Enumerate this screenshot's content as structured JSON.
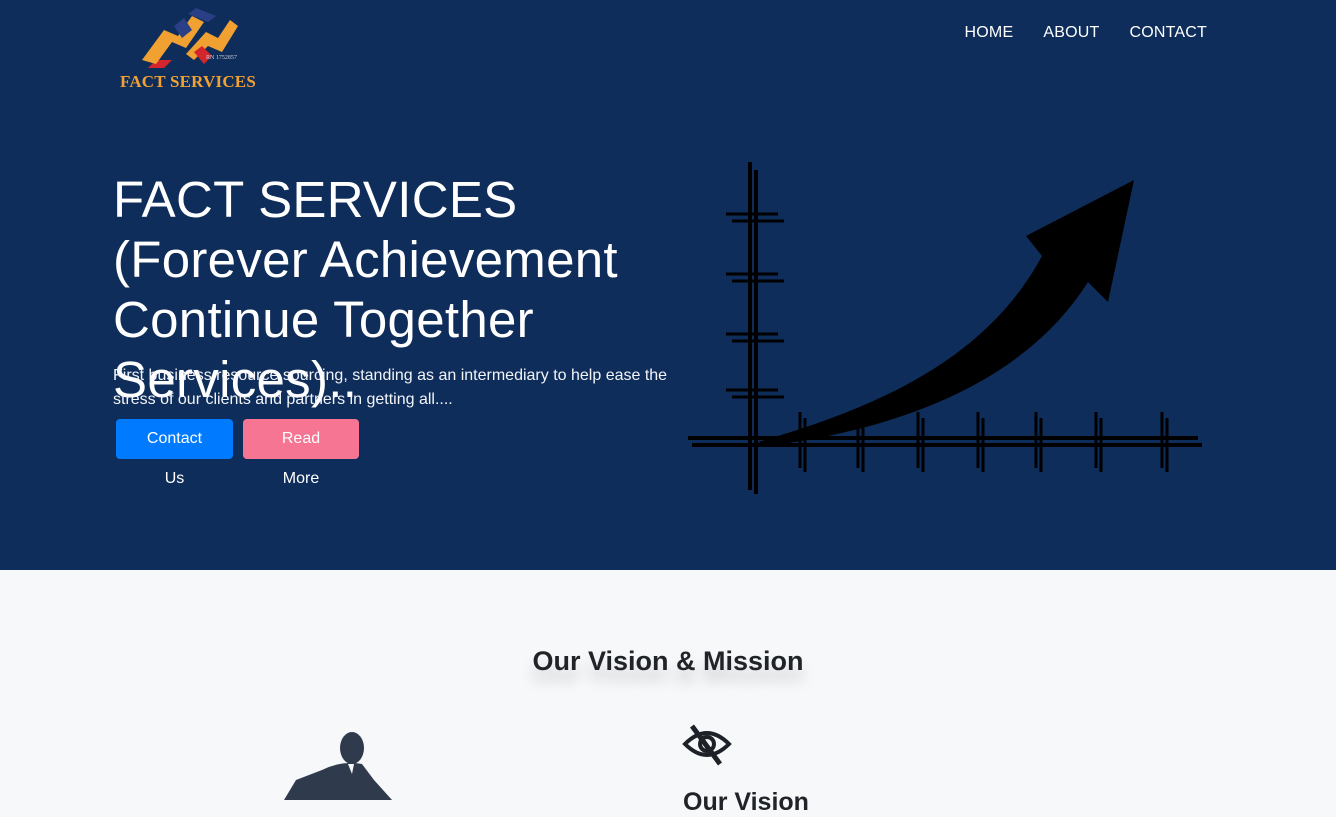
{
  "brand": {
    "name": "FACT SERVICES",
    "registration": "RN 1752857"
  },
  "nav": {
    "items": [
      "HOME",
      "ABOUT",
      "CONTACT"
    ]
  },
  "hero": {
    "title": "FACT SERVICES (Forever Achievement Continue Together Services)..",
    "description": "First business resource sourcing, standing as an intermediary to help ease the stress of our clients and partners in getting all....",
    "buttons": {
      "contact": "Contact Us",
      "read_more": "Read More"
    }
  },
  "vision_mission": {
    "title": "Our Vision & Mission",
    "vision_heading": "Our Vision"
  },
  "colors": {
    "hero_bg": "#0f2d5a",
    "primary": "#007bff",
    "pink": "#f57592",
    "logo_orange": "#f0a132"
  },
  "icons": {
    "logo": "lightning-arrows-logo",
    "graph": "growth-chart-arrow",
    "person": "person-icon",
    "eye": "eye-slash-icon"
  }
}
